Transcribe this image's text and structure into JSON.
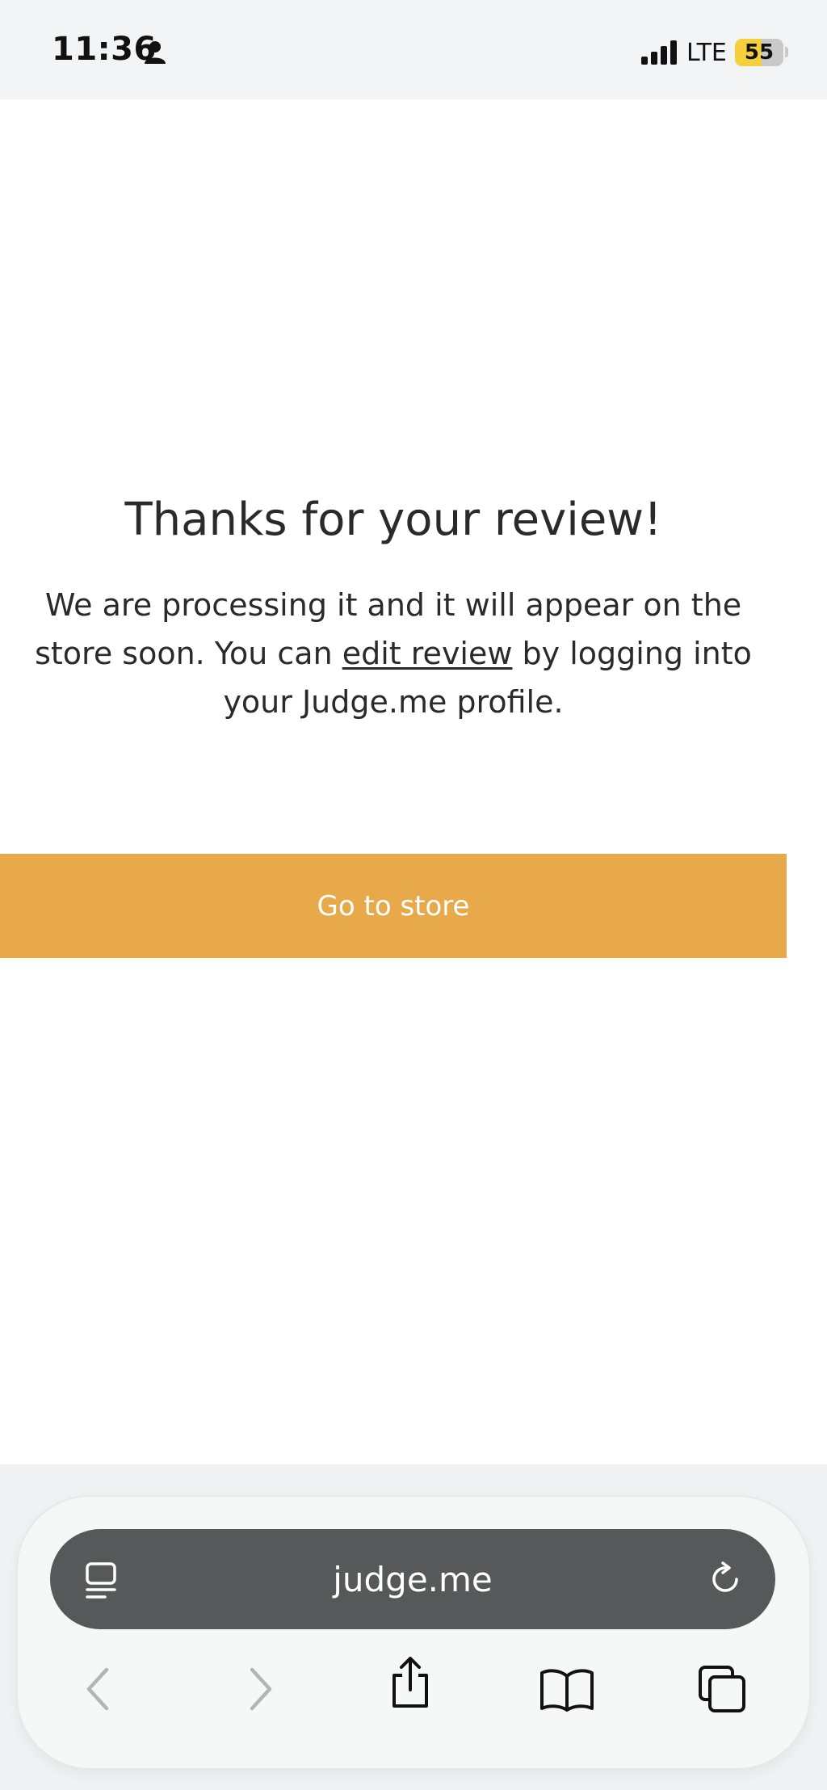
{
  "status_bar": {
    "time": "11:36",
    "network": "LTE",
    "battery_percent": "55",
    "battery_level": 0.55
  },
  "content": {
    "heading": "Thanks for your review!",
    "message_part1": "We are processing it and it will appear on the store soon. You can ",
    "edit_link_label": "edit review",
    "message_part2": " by logging into your Judge.me profile.",
    "button_label": "Go to store"
  },
  "browser": {
    "url": "judge.me",
    "icons": [
      "reader-icon",
      "reload-icon",
      "back-icon",
      "forward-icon",
      "share-icon",
      "bookmarks-icon",
      "tabs-icon"
    ]
  },
  "colors": {
    "accent": "#e8a94a",
    "address_bar": "#575859",
    "battery_fill": "#f5cf3c"
  }
}
